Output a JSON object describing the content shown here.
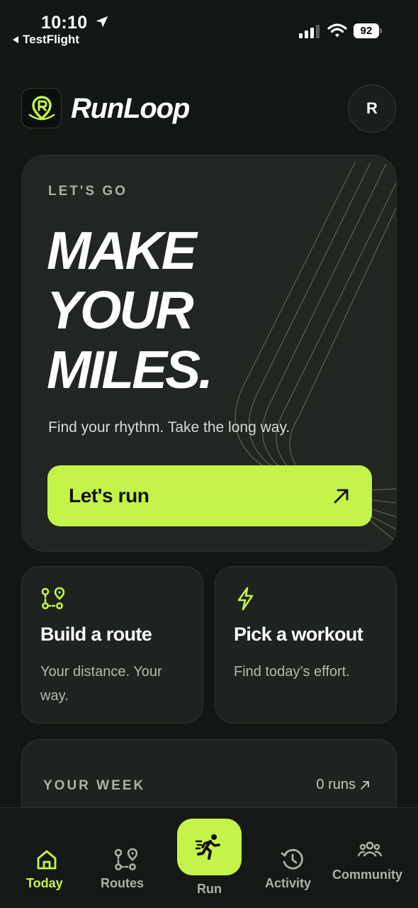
{
  "status_bar": {
    "time": "10:10",
    "back_app": "TestFlight",
    "battery": "92"
  },
  "header": {
    "brand": "RunLoop",
    "avatar_initial": "R",
    "logo_icon": "runloop-pin-logo-icon"
  },
  "hero": {
    "eyebrow": "LET'S GO",
    "title_line1": "MAKE",
    "title_line2": "YOUR",
    "title_line3": "MILES.",
    "subtitle": "Find your rhythm. Take the long way.",
    "cta_label": "Let's run",
    "cta_icon": "arrow-up-right-icon"
  },
  "cards": [
    {
      "icon": "route-pins-icon",
      "title": "Build a route",
      "subtitle": "Your distance. Your way."
    },
    {
      "icon": "lightning-bolt-icon",
      "title": "Pick a workout",
      "subtitle": "Find today’s effort."
    }
  ],
  "week": {
    "title": "YOUR WEEK",
    "runs": "0 runs"
  },
  "tabs": [
    {
      "label": "Today",
      "icon": "home-icon",
      "active": true
    },
    {
      "label": "Routes",
      "icon": "route-pins-icon",
      "active": false
    },
    {
      "label": "Run",
      "icon": "runner-icon",
      "active": false
    },
    {
      "label": "Activity",
      "icon": "history-clock-icon",
      "active": false
    },
    {
      "label": "Community",
      "icon": "group-icon",
      "active": false
    }
  ],
  "colors": {
    "background": "#131713",
    "card": "#212622",
    "accent": "#c4f44a",
    "muted_text": "#aab0aa"
  }
}
